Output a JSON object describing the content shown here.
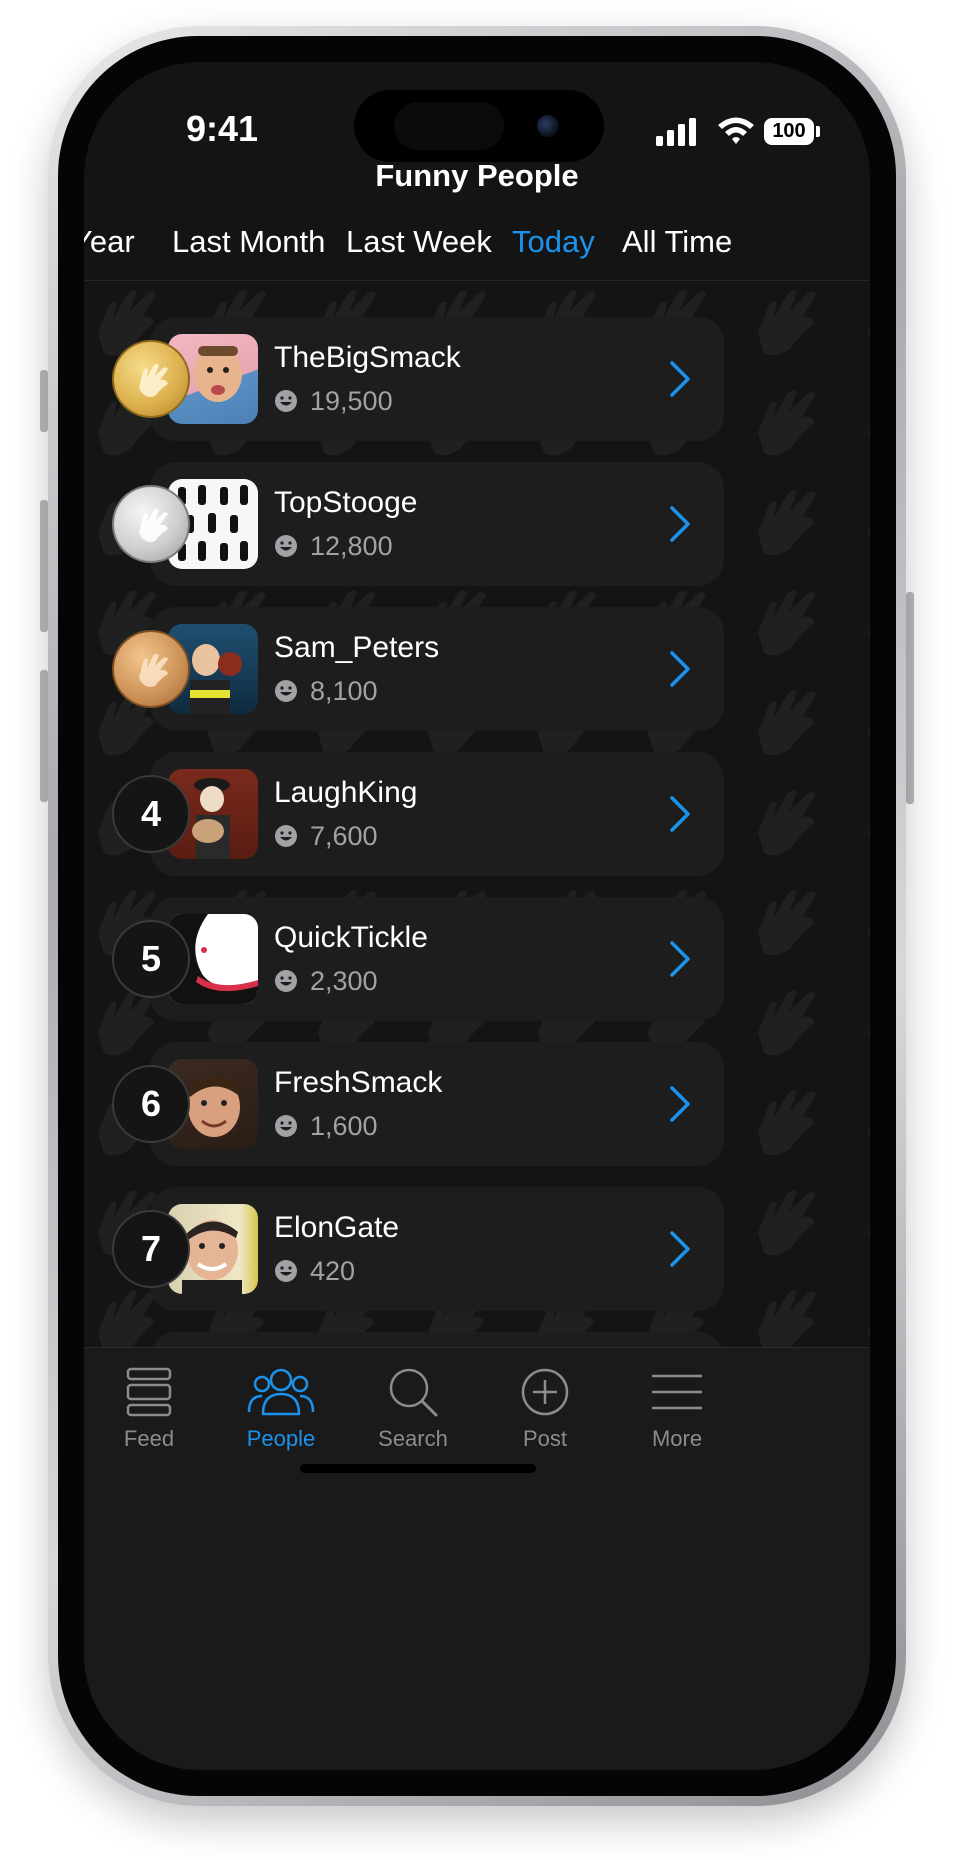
{
  "status_bar": {
    "time": "9:41",
    "battery": "100"
  },
  "header": {
    "title": "Funny People"
  },
  "tabs": [
    {
      "label": "Year",
      "active": false
    },
    {
      "label": "Last Month",
      "active": false
    },
    {
      "label": "Last Week",
      "active": false
    },
    {
      "label": "Today",
      "active": true
    },
    {
      "label": "All Time",
      "active": false
    }
  ],
  "leaders": [
    {
      "rank": "1",
      "medal": "gold",
      "username": "TheBigSmack",
      "score": "19,500"
    },
    {
      "rank": "2",
      "medal": "silver",
      "username": "TopStooge",
      "score": "12,800"
    },
    {
      "rank": "3",
      "medal": "bronze",
      "username": "Sam_Peters",
      "score": "8,100"
    },
    {
      "rank": "4",
      "medal": "none",
      "username": "LaughKing",
      "score": "7,600"
    },
    {
      "rank": "5",
      "medal": "none",
      "username": "QuickTickle",
      "score": "2,300"
    },
    {
      "rank": "6",
      "medal": "none",
      "username": "FreshSmack",
      "score": "1,600"
    },
    {
      "rank": "7",
      "medal": "none",
      "username": "ElonGate",
      "score": "420"
    }
  ],
  "nav": [
    {
      "label": "Feed",
      "icon": "feed-icon",
      "active": false
    },
    {
      "label": "People",
      "icon": "people-icon",
      "active": true
    },
    {
      "label": "Search",
      "icon": "search-icon",
      "active": false
    },
    {
      "label": "Post",
      "icon": "post-icon",
      "active": false
    },
    {
      "label": "More",
      "icon": "more-icon",
      "active": false
    }
  ],
  "colors": {
    "accent": "#1b93ec",
    "background": "#141414",
    "row": "#1d1d1e",
    "muted_text": "#a2a2a6"
  }
}
